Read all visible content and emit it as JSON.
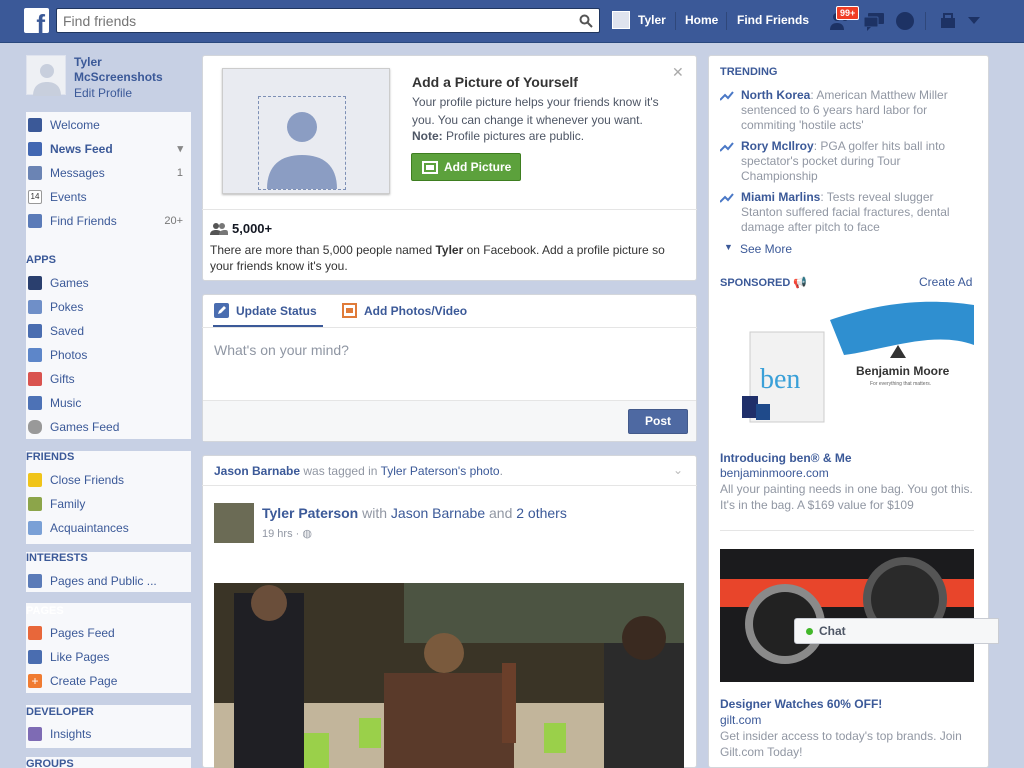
{
  "topbar": {
    "search_placeholder": "Find friends",
    "user": "Tyler",
    "home": "Home",
    "find_friends": "Find Friends",
    "notif_badge": "99+"
  },
  "sidebar": {
    "profile_name": "Tyler McScreenshots",
    "edit_profile": "Edit Profile",
    "main": [
      {
        "label": "Welcome",
        "count": ""
      },
      {
        "label": "News Feed",
        "count": ""
      },
      {
        "label": "Messages",
        "count": "1"
      },
      {
        "label": "Events",
        "count": ""
      },
      {
        "label": "Find Friends",
        "count": "20+"
      }
    ],
    "apps_head": "APPS",
    "apps": [
      "Games",
      "Pokes",
      "Saved",
      "Photos",
      "Gifts",
      "Music",
      "Games Feed"
    ],
    "friends_head": "FRIENDS",
    "friends": [
      "Close Friends",
      "Family",
      "Acquaintances"
    ],
    "interests_head": "INTERESTS",
    "interests": [
      "Pages and Public ..."
    ],
    "pages_head": "PAGES",
    "pages": [
      "Pages Feed",
      "Like Pages",
      "Create Page"
    ],
    "developer_head": "DEVELOPER",
    "developer": [
      "Insights"
    ],
    "groups_head": "GROUPS"
  },
  "add_picture": {
    "title": "Add a Picture of Yourself",
    "body": "Your profile picture helps your friends know it's you. You can change it whenever you want.",
    "note_label": "Note:",
    "note_text": " Profile pictures are public.",
    "button": "Add Picture",
    "count": "5,000+",
    "count_text_pre": "There are more than 5,000 people named ",
    "count_name": "Tyler",
    "count_text_post": " on Facebook. Add a profile picture so your friends know it's you."
  },
  "composer": {
    "tab_status": "Update Status",
    "tab_photo": "Add Photos/Video",
    "placeholder": "What's on your mind?",
    "post": "Post"
  },
  "story": {
    "actor": "Jason Barnabe",
    "verb": " was tagged in ",
    "owner": "Tyler Paterson's",
    "object": "photo",
    "author": "Tyler Paterson",
    "with": " with ",
    "with_name": "Jason Barnabe",
    "and": " and ",
    "others": "2 others",
    "time": "19 hrs · "
  },
  "right": {
    "trending_head": "TRENDING",
    "trends": [
      {
        "name": "North Korea",
        "text": ": American Matthew Miller sentenced to 6 years hard labor for commiting 'hostile acts'"
      },
      {
        "name": "Rory McIlroy",
        "text": ": PGA golfer hits ball into spectator's pocket during Tour Championship"
      },
      {
        "name": "Miami Marlins",
        "text": ": Tests reveal slugger Stanton suffered facial fractures, dental damage after pitch to face"
      }
    ],
    "see_more": "See More",
    "sponsored_head": "SPONSORED",
    "create_ad": "Create Ad",
    "ad1": {
      "logo": "Benjamin Moore",
      "tagline": "For everything that matters.",
      "bag_text": "ben",
      "title": "Introducing ben® & Me",
      "url": "benjaminmoore.com",
      "desc": "All your painting needs in one bag. You got this. It's in the bag. A $169 value for $109"
    },
    "ad2": {
      "title": "Designer Watches 60% OFF!",
      "url": "gilt.com",
      "desc": "Get insider access to today's top brands. Join Gilt.com Today!"
    },
    "chat": "Chat"
  }
}
